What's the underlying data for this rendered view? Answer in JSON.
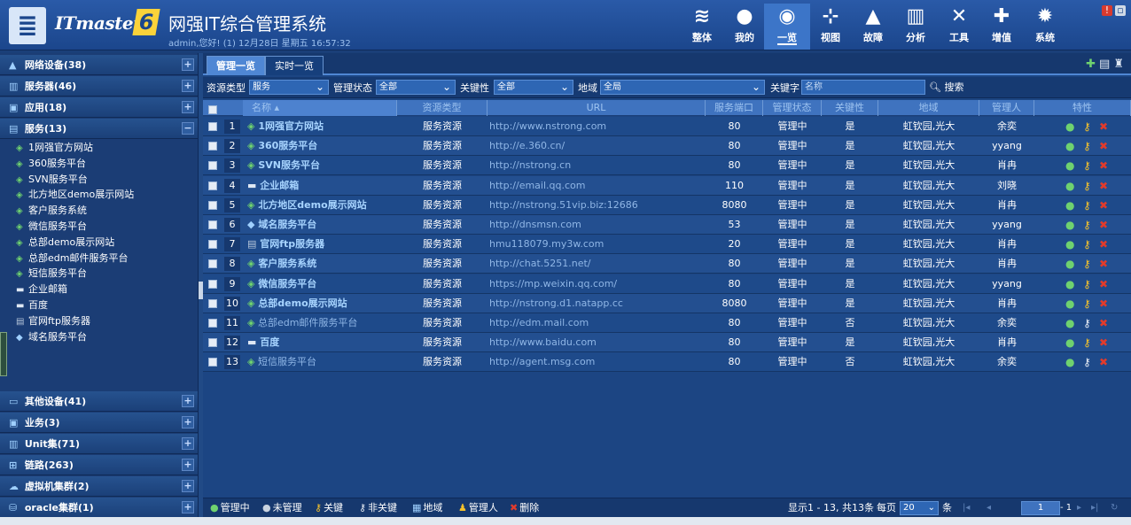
{
  "header": {
    "brand": "ITmaster",
    "brand_num": "6",
    "title": "网强IT综合管理系统",
    "user_info": "admin,您好! (1) 12月28日 星期五 16:57:32",
    "nav": [
      {
        "label": "整体",
        "icon": "layers-icon",
        "glyph": "≋"
      },
      {
        "label": "我的",
        "icon": "user-icon",
        "glyph": "●"
      },
      {
        "label": "一览",
        "icon": "overview-icon",
        "glyph": "◉"
      },
      {
        "label": "视图",
        "icon": "topology-icon",
        "glyph": "⊹"
      },
      {
        "label": "故障",
        "icon": "warning-icon",
        "glyph": "▲"
      },
      {
        "label": "分析",
        "icon": "chart-icon",
        "glyph": "▥"
      },
      {
        "label": "工具",
        "icon": "tools-icon",
        "glyph": "✕"
      },
      {
        "label": "增值",
        "icon": "plus-icon",
        "glyph": "✚"
      },
      {
        "label": "系统",
        "icon": "gear-icon",
        "glyph": "✹"
      }
    ]
  },
  "sidebar": {
    "categories_top": [
      {
        "label": "网络设备(38)",
        "btn": "+"
      },
      {
        "label": "服务器(46)",
        "btn": "+"
      },
      {
        "label": "应用(18)",
        "btn": "+"
      },
      {
        "label": "服务(13)",
        "btn": "−"
      }
    ],
    "tree": [
      "1网强官方网站",
      "360服务平台",
      "SVN服务平台",
      "北方地区demo展示网站",
      "客户服务系统",
      "微信服务平台",
      "总部demo展示网站",
      "总部edm邮件服务平台",
      "短信服务平台",
      "企业邮箱",
      "百度",
      "官网ftp服务器",
      "域名服务平台"
    ],
    "categories_bottom": [
      {
        "label": "其他设备(41)",
        "btn": "+"
      },
      {
        "label": "业务(3)",
        "btn": "+"
      },
      {
        "label": "Unit集(71)",
        "btn": "+"
      },
      {
        "label": "链路(263)",
        "btn": "+"
      },
      {
        "label": "虚拟机集群(2)",
        "btn": "+"
      },
      {
        "label": "oracle集群(1)",
        "btn": "+"
      }
    ]
  },
  "tabs": [
    "管理一览",
    "实时一览"
  ],
  "filters": {
    "resource_type_label": "资源类型",
    "resource_type_value": "服务",
    "manage_status_label": "管理状态",
    "manage_status_value": "全部",
    "key_label": "关键性",
    "key_value": "全部",
    "region_label": "地域",
    "region_value": "全局",
    "keyword_label": "关键字",
    "keyword_placeholder": "名称",
    "search_label": "搜索"
  },
  "table": {
    "columns": [
      "名称 ▴",
      "资源类型",
      "URL",
      "服务端口",
      "管理状态",
      "关键性",
      "地域",
      "管理人",
      "特性"
    ],
    "rows": [
      {
        "n": "1",
        "name": "1网强官方网站",
        "type": "服务资源",
        "url": "http://www.nstrong.com",
        "port": "80",
        "status": "管理中",
        "key": "是",
        "region": "虹钦园,光大",
        "owner": "余奕"
      },
      {
        "n": "2",
        "name": "360服务平台",
        "type": "服务资源",
        "url": "http://e.360.cn/",
        "port": "80",
        "status": "管理中",
        "key": "是",
        "region": "虹钦园,光大",
        "owner": "yyang"
      },
      {
        "n": "3",
        "name": "SVN服务平台",
        "type": "服务资源",
        "url": "http://nstrong.cn",
        "port": "80",
        "status": "管理中",
        "key": "是",
        "region": "虹钦园,光大",
        "owner": "肖冉"
      },
      {
        "n": "4",
        "name": "企业邮箱",
        "type": "服务资源",
        "url": "http://email.qq.com",
        "port": "110",
        "status": "管理中",
        "key": "是",
        "region": "虹钦园,光大",
        "owner": "刘晓"
      },
      {
        "n": "5",
        "name": "北方地区demo展示网站",
        "type": "服务资源",
        "url": "http://nstrong.51vip.biz:12686",
        "port": "8080",
        "status": "管理中",
        "key": "是",
        "region": "虹钦园,光大",
        "owner": "肖冉"
      },
      {
        "n": "6",
        "name": "域名服务平台",
        "type": "服务资源",
        "url": "http://dnsmsn.com",
        "port": "53",
        "status": "管理中",
        "key": "是",
        "region": "虹钦园,光大",
        "owner": "yyang"
      },
      {
        "n": "7",
        "name": "官网ftp服务器",
        "type": "服务资源",
        "url": "hmu118079.my3w.com",
        "port": "20",
        "status": "管理中",
        "key": "是",
        "region": "虹钦园,光大",
        "owner": "肖冉"
      },
      {
        "n": "8",
        "name": "客户服务系统",
        "type": "服务资源",
        "url": "http://chat.5251.net/",
        "port": "80",
        "status": "管理中",
        "key": "是",
        "region": "虹钦园,光大",
        "owner": "肖冉"
      },
      {
        "n": "9",
        "name": "微信服务平台",
        "type": "服务资源",
        "url": "https://mp.weixin.qq.com/",
        "port": "80",
        "status": "管理中",
        "key": "是",
        "region": "虹钦园,光大",
        "owner": "yyang"
      },
      {
        "n": "10",
        "name": "总部demo展示网站",
        "type": "服务资源",
        "url": "http://nstrong.d1.natapp.cc",
        "port": "8080",
        "status": "管理中",
        "key": "是",
        "region": "虹钦园,光大",
        "owner": "肖冉"
      },
      {
        "n": "11",
        "name": "总部edm邮件服务平台",
        "type": "服务资源",
        "url": "http://edm.mail.com",
        "port": "80",
        "status": "管理中",
        "key": "否",
        "region": "虹钦园,光大",
        "owner": "余奕"
      },
      {
        "n": "12",
        "name": "百度",
        "type": "服务资源",
        "url": "http://www.baidu.com",
        "port": "80",
        "status": "管理中",
        "key": "是",
        "region": "虹钦园,光大",
        "owner": "肖冉"
      },
      {
        "n": "13",
        "name": "短信服务平台",
        "type": "服务资源",
        "url": "http://agent.msg.com",
        "port": "80",
        "status": "管理中",
        "key": "否",
        "region": "虹钦园,光大",
        "owner": "余奕"
      }
    ]
  },
  "footer": {
    "actions": [
      {
        "label": "管理中",
        "icon": "managed-icon",
        "glyph": "●",
        "color": "#6fd26f"
      },
      {
        "label": "未管理",
        "icon": "unmanaged-icon",
        "glyph": "●",
        "color": "#c9d3e0"
      },
      {
        "label": "关键",
        "icon": "key-icon",
        "glyph": "⚷",
        "color": "#f5c22b"
      },
      {
        "label": "非关键",
        "icon": "nonkey-icon",
        "glyph": "⚷",
        "color": "#e9eef5"
      },
      {
        "label": "地域",
        "icon": "region-icon",
        "glyph": "▦",
        "color": "#9fd0ff"
      },
      {
        "label": "管理人",
        "icon": "owner-icon",
        "glyph": "♟",
        "color": "#f5c22b"
      },
      {
        "label": "删除",
        "icon": "delete-icon",
        "glyph": "✖",
        "color": "#e23b2b"
      }
    ],
    "pager_info": "显示1 - 13, 共13条",
    "per_page_label": "每页",
    "per_page_value": "20",
    "per_page_unit": "条",
    "page_value": "1",
    "page_total": "- 1"
  },
  "colors": {
    "accent": "#4f87d4",
    "header": "#1b468c",
    "row_odd": "#1e4a8a",
    "row_even": "#234f90"
  }
}
